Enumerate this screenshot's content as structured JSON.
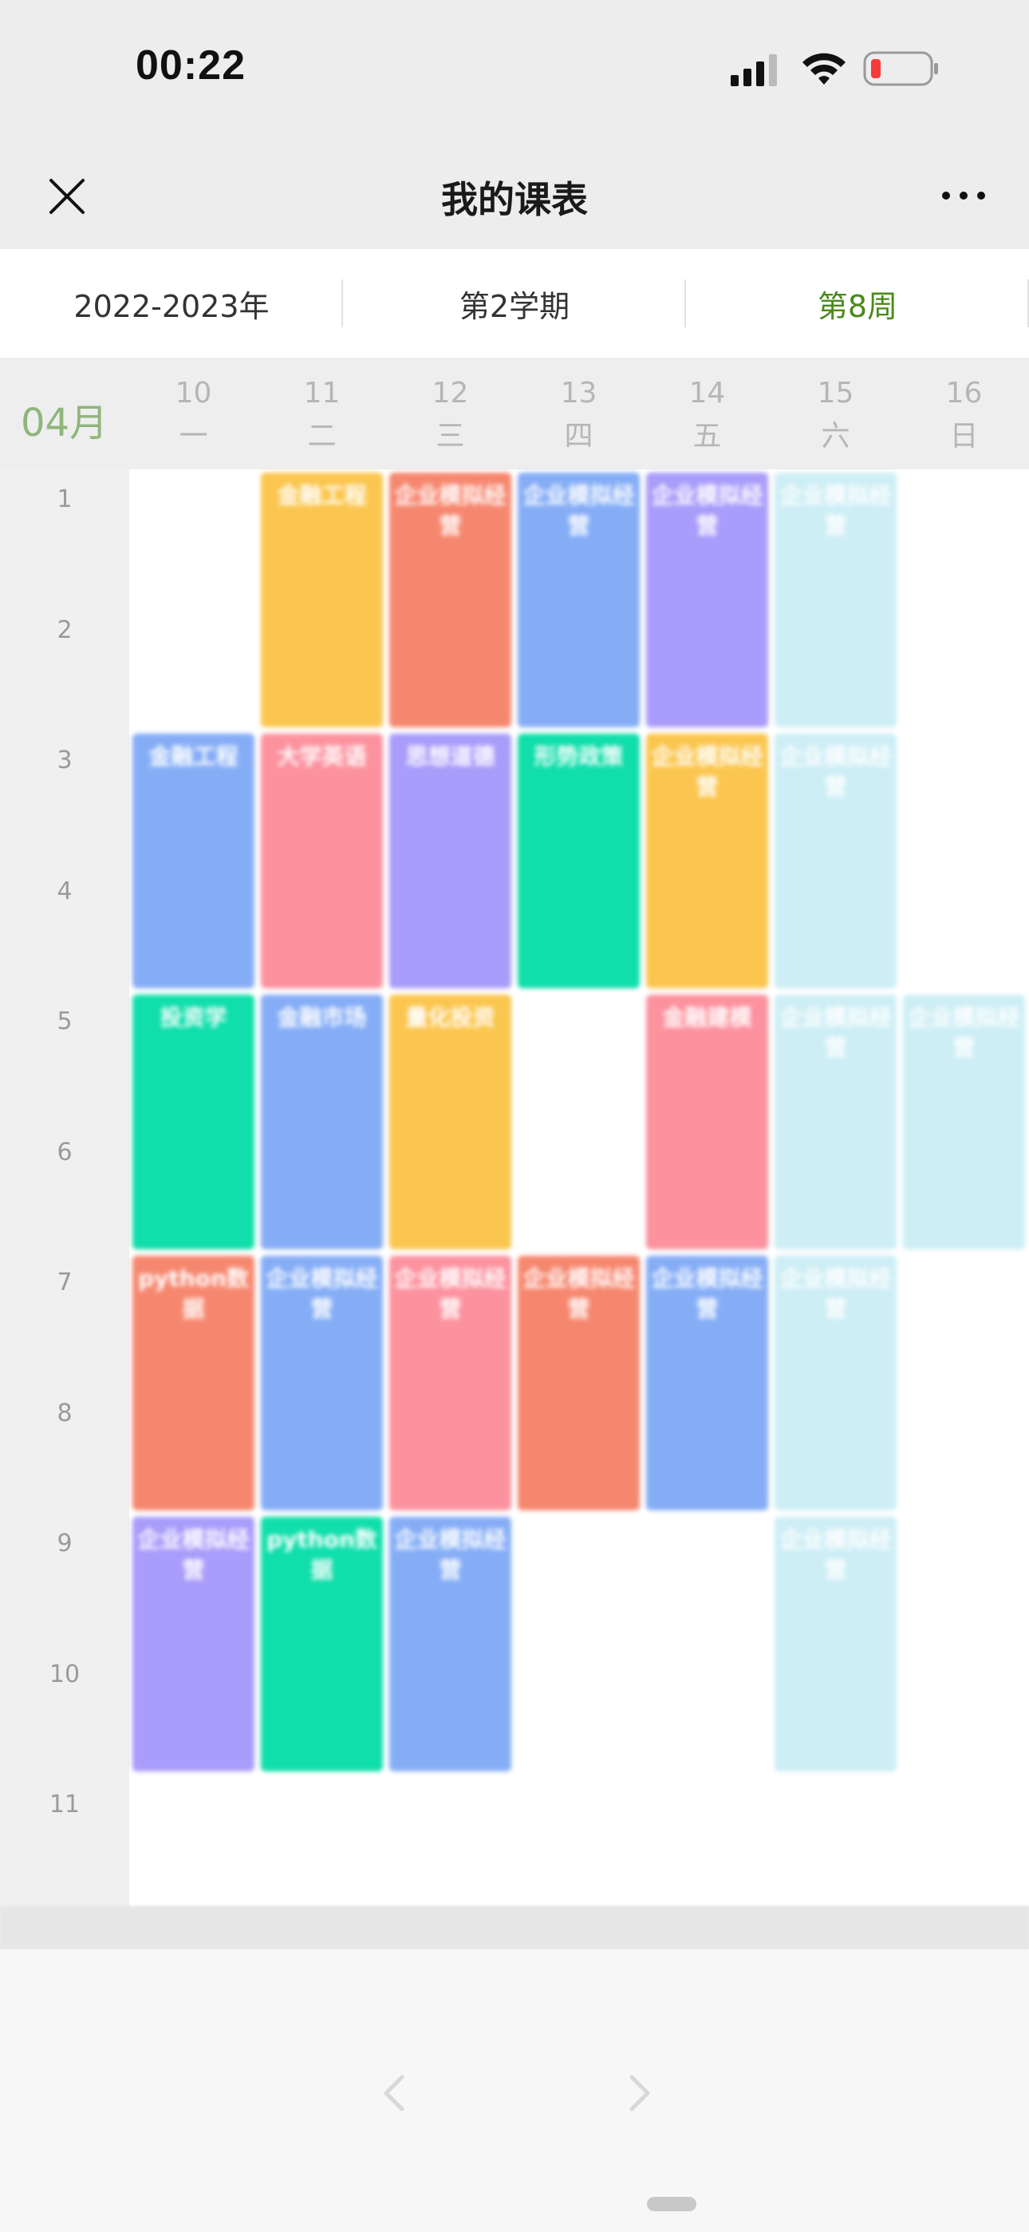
{
  "status": {
    "time": "00:22"
  },
  "nav": {
    "title": "我的课表"
  },
  "tabs": [
    {
      "label": "2022-2023年"
    },
    {
      "label": "第2学期"
    },
    {
      "label": "第8周"
    }
  ],
  "header": {
    "month": "04月",
    "days": [
      {
        "num": "10",
        "wk": "一"
      },
      {
        "num": "11",
        "wk": "二"
      },
      {
        "num": "12",
        "wk": "三"
      },
      {
        "num": "13",
        "wk": "四"
      },
      {
        "num": "14",
        "wk": "五"
      },
      {
        "num": "15",
        "wk": "六"
      },
      {
        "num": "16",
        "wk": "日"
      }
    ]
  },
  "periods": [
    "1",
    "2",
    "3",
    "4",
    "5",
    "6",
    "7",
    "8",
    "9",
    "10",
    "11"
  ],
  "courses": [
    {
      "day": 1,
      "start": 1,
      "span": 2,
      "color": "#fbc64f",
      "name": "金融工程"
    },
    {
      "day": 2,
      "start": 1,
      "span": 2,
      "color": "#f6876f",
      "name": "企业模拟经营"
    },
    {
      "day": 3,
      "start": 1,
      "span": 2,
      "color": "#85adf6",
      "name": "企业模拟经营"
    },
    {
      "day": 4,
      "start": 1,
      "span": 2,
      "color": "#a99cfa",
      "name": "企业模拟经营"
    },
    {
      "day": 5,
      "start": 1,
      "span": 2,
      "color": "#cdeef5",
      "name": "企业模拟经营"
    },
    {
      "day": 0,
      "start": 3,
      "span": 2,
      "color": "#85adf6",
      "name": "金融工程"
    },
    {
      "day": 1,
      "start": 3,
      "span": 2,
      "color": "#fc929e",
      "name": "大学英语"
    },
    {
      "day": 2,
      "start": 3,
      "span": 2,
      "color": "#a99cfa",
      "name": "思想道德"
    },
    {
      "day": 3,
      "start": 3,
      "span": 2,
      "color": "#10deab",
      "name": "形势政策"
    },
    {
      "day": 4,
      "start": 3,
      "span": 2,
      "color": "#fbc64f",
      "name": "企业模拟经营"
    },
    {
      "day": 5,
      "start": 3,
      "span": 2,
      "color": "#cdeef5",
      "name": "企业模拟经营"
    },
    {
      "day": 0,
      "start": 5,
      "span": 2,
      "color": "#10deab",
      "name": "投资学"
    },
    {
      "day": 1,
      "start": 5,
      "span": 2,
      "color": "#85adf6",
      "name": "金融市场"
    },
    {
      "day": 2,
      "start": 5,
      "span": 2,
      "color": "#fbc64f",
      "name": "量化投资"
    },
    {
      "day": 4,
      "start": 5,
      "span": 2,
      "color": "#fc929e",
      "name": "金融建模"
    },
    {
      "day": 5,
      "start": 5,
      "span": 2,
      "color": "#cdeef5",
      "name": "企业模拟经营"
    },
    {
      "day": 6,
      "start": 5,
      "span": 2,
      "color": "#cdeef5",
      "name": "企业模拟经营"
    },
    {
      "day": 0,
      "start": 7,
      "span": 2,
      "color": "#f6876f",
      "name": "python数据"
    },
    {
      "day": 1,
      "start": 7,
      "span": 2,
      "color": "#85adf6",
      "name": "企业模拟经营"
    },
    {
      "day": 2,
      "start": 7,
      "span": 2,
      "color": "#fc929e",
      "name": "企业模拟经营"
    },
    {
      "day": 3,
      "start": 7,
      "span": 2,
      "color": "#f6876f",
      "name": "企业模拟经营"
    },
    {
      "day": 4,
      "start": 7,
      "span": 2,
      "color": "#85adf6",
      "name": "企业模拟经营"
    },
    {
      "day": 5,
      "start": 7,
      "span": 2,
      "color": "#cdeef5",
      "name": "企业模拟经营"
    },
    {
      "day": 0,
      "start": 9,
      "span": 2,
      "color": "#a99cfa",
      "name": "企业模拟经营"
    },
    {
      "day": 1,
      "start": 9,
      "span": 2,
      "color": "#10deab",
      "name": "python数据"
    },
    {
      "day": 2,
      "start": 9,
      "span": 2,
      "color": "#85adf6",
      "name": "企业模拟经营"
    },
    {
      "day": 5,
      "start": 9,
      "span": 2,
      "color": "#cdeef5",
      "name": "企业模拟经营"
    }
  ]
}
